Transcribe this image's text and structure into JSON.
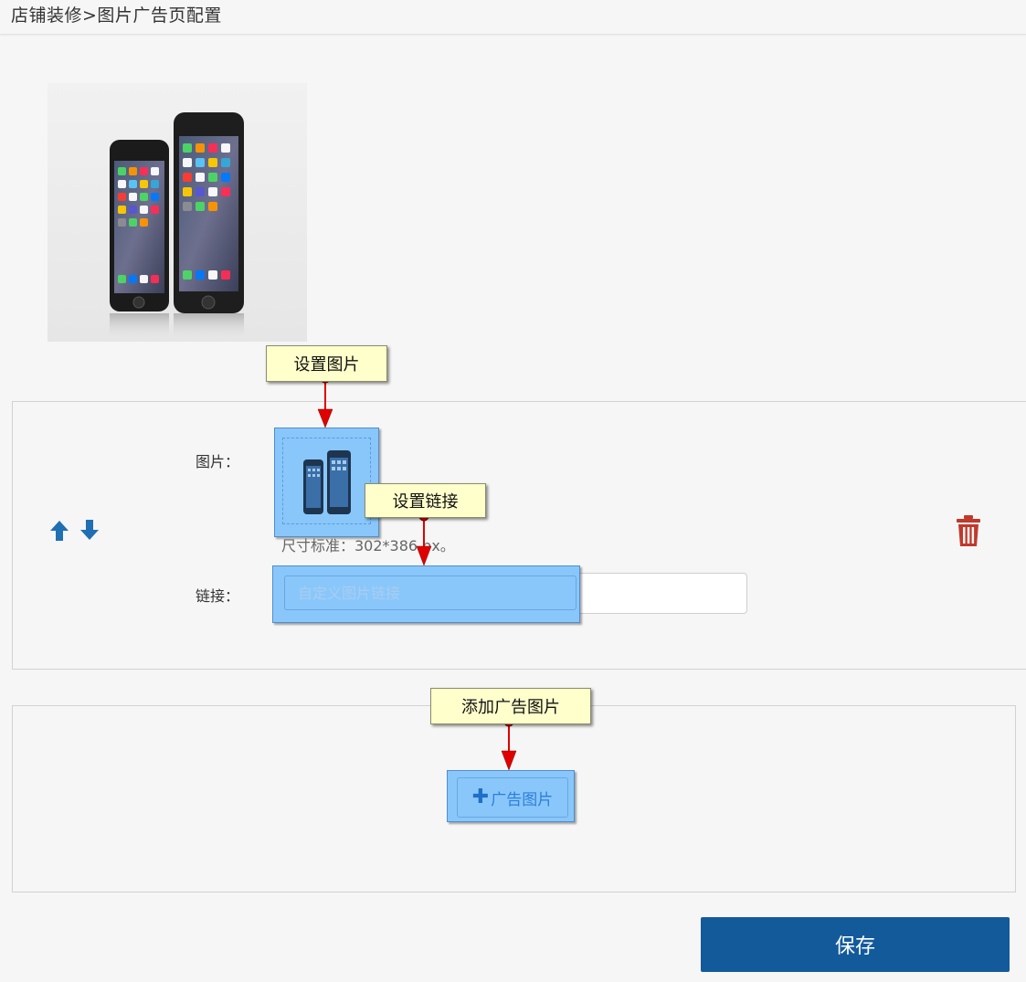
{
  "header": {
    "breadcrumb": "店铺装修>图片广告页配置"
  },
  "item": {
    "image_label": "图片：",
    "link_label": "链接：",
    "size_hint": "尺寸标准：302*386 px。",
    "link_placeholder": "自定义图片链接"
  },
  "add_section": {
    "button_plus": "✚",
    "button_label": "广告图片"
  },
  "annotations": {
    "set_image": "设置图片",
    "set_link": "设置链接",
    "add_ad_image": "添加广告图片"
  },
  "footer": {
    "save_label": "保存"
  },
  "colors": {
    "accent": "#135a9b",
    "arrow_blue": "#1f6fb2",
    "trash_red": "#c0392b",
    "highlight": "#89c7fb",
    "callout_bg": "#ffffcc",
    "annotation_arrow": "#e00000"
  }
}
